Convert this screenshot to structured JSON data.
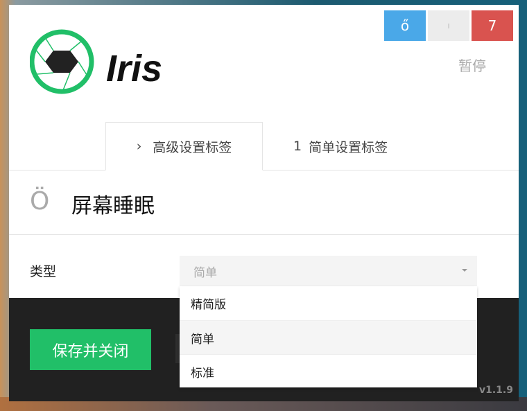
{
  "app": {
    "logo_text": "Iris",
    "brand_color": "#21bf68"
  },
  "window_controls": {
    "minimize": "ő",
    "maximize": "ı",
    "close": "7"
  },
  "pause_label": "暂停",
  "tabs": [
    {
      "icon": "›",
      "label": "高级设置标签",
      "active": true
    },
    {
      "icon": "1",
      "label": "简单设置标签",
      "active": false
    }
  ],
  "section": {
    "icon": "Ö",
    "title": "屏幕睡眠"
  },
  "type_field": {
    "label": "类型",
    "value": "简单",
    "options": [
      "精简版",
      "简单",
      "标准"
    ],
    "highlighted": "简单"
  },
  "footer": {
    "save_label": "保存并关闭",
    "version": "v1.1.9"
  }
}
